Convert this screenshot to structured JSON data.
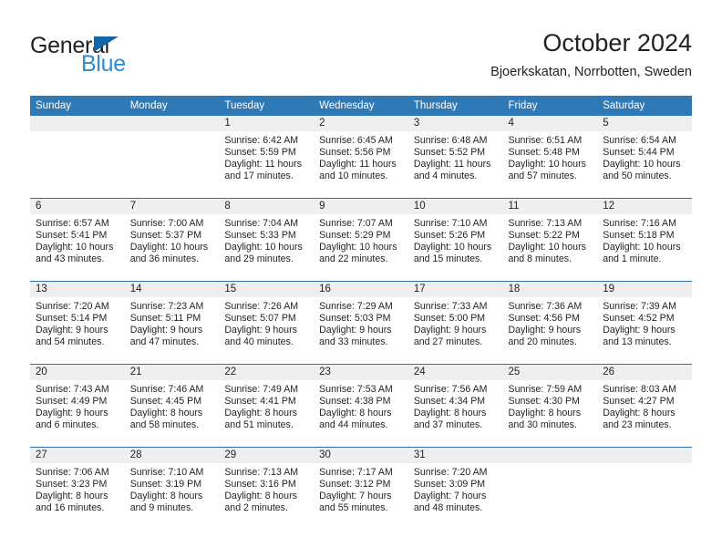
{
  "brand": {
    "name_part1": "General",
    "name_part2": "Blue",
    "triangle_color": "#1464aa",
    "blue_color": "#2e8bd0"
  },
  "header": {
    "title": "October 2024",
    "subtitle": "Bjoerkskatan, Norrbotten, Sweden"
  },
  "theme": {
    "header_row_bg": "#3079b7",
    "header_row_text": "#ffffff",
    "row_divider": "#2f73ad",
    "daynum_band_bg": "#efeff0",
    "text": "#231f20"
  },
  "weekdays": [
    "Sunday",
    "Monday",
    "Tuesday",
    "Wednesday",
    "Thursday",
    "Friday",
    "Saturday"
  ],
  "labels": {
    "sunrise_prefix": "Sunrise:",
    "sunset_prefix": "Sunset:",
    "daylight_prefix": "Daylight:"
  },
  "weeks": [
    [
      {
        "day": "",
        "empty": true,
        "l1": "",
        "l2": "",
        "l3": "",
        "l4": ""
      },
      {
        "day": "",
        "empty": true,
        "l1": "",
        "l2": "",
        "l3": "",
        "l4": ""
      },
      {
        "day": "1",
        "empty": false,
        "l1": "Sunrise: 6:42 AM",
        "l2": "Sunset: 5:59 PM",
        "l3": "Daylight: 11 hours",
        "l4": "and 17 minutes."
      },
      {
        "day": "2",
        "empty": false,
        "l1": "Sunrise: 6:45 AM",
        "l2": "Sunset: 5:56 PM",
        "l3": "Daylight: 11 hours",
        "l4": "and 10 minutes."
      },
      {
        "day": "3",
        "empty": false,
        "l1": "Sunrise: 6:48 AM",
        "l2": "Sunset: 5:52 PM",
        "l3": "Daylight: 11 hours",
        "l4": "and 4 minutes."
      },
      {
        "day": "4",
        "empty": false,
        "l1": "Sunrise: 6:51 AM",
        "l2": "Sunset: 5:48 PM",
        "l3": "Daylight: 10 hours",
        "l4": "and 57 minutes."
      },
      {
        "day": "5",
        "empty": false,
        "l1": "Sunrise: 6:54 AM",
        "l2": "Sunset: 5:44 PM",
        "l3": "Daylight: 10 hours",
        "l4": "and 50 minutes."
      }
    ],
    [
      {
        "day": "6",
        "empty": false,
        "l1": "Sunrise: 6:57 AM",
        "l2": "Sunset: 5:41 PM",
        "l3": "Daylight: 10 hours",
        "l4": "and 43 minutes."
      },
      {
        "day": "7",
        "empty": false,
        "l1": "Sunrise: 7:00 AM",
        "l2": "Sunset: 5:37 PM",
        "l3": "Daylight: 10 hours",
        "l4": "and 36 minutes."
      },
      {
        "day": "8",
        "empty": false,
        "l1": "Sunrise: 7:04 AM",
        "l2": "Sunset: 5:33 PM",
        "l3": "Daylight: 10 hours",
        "l4": "and 29 minutes."
      },
      {
        "day": "9",
        "empty": false,
        "l1": "Sunrise: 7:07 AM",
        "l2": "Sunset: 5:29 PM",
        "l3": "Daylight: 10 hours",
        "l4": "and 22 minutes."
      },
      {
        "day": "10",
        "empty": false,
        "l1": "Sunrise: 7:10 AM",
        "l2": "Sunset: 5:26 PM",
        "l3": "Daylight: 10 hours",
        "l4": "and 15 minutes."
      },
      {
        "day": "11",
        "empty": false,
        "l1": "Sunrise: 7:13 AM",
        "l2": "Sunset: 5:22 PM",
        "l3": "Daylight: 10 hours",
        "l4": "and 8 minutes."
      },
      {
        "day": "12",
        "empty": false,
        "l1": "Sunrise: 7:16 AM",
        "l2": "Sunset: 5:18 PM",
        "l3": "Daylight: 10 hours",
        "l4": "and 1 minute."
      }
    ],
    [
      {
        "day": "13",
        "empty": false,
        "l1": "Sunrise: 7:20 AM",
        "l2": "Sunset: 5:14 PM",
        "l3": "Daylight: 9 hours",
        "l4": "and 54 minutes."
      },
      {
        "day": "14",
        "empty": false,
        "l1": "Sunrise: 7:23 AM",
        "l2": "Sunset: 5:11 PM",
        "l3": "Daylight: 9 hours",
        "l4": "and 47 minutes."
      },
      {
        "day": "15",
        "empty": false,
        "l1": "Sunrise: 7:26 AM",
        "l2": "Sunset: 5:07 PM",
        "l3": "Daylight: 9 hours",
        "l4": "and 40 minutes."
      },
      {
        "day": "16",
        "empty": false,
        "l1": "Sunrise: 7:29 AM",
        "l2": "Sunset: 5:03 PM",
        "l3": "Daylight: 9 hours",
        "l4": "and 33 minutes."
      },
      {
        "day": "17",
        "empty": false,
        "l1": "Sunrise: 7:33 AM",
        "l2": "Sunset: 5:00 PM",
        "l3": "Daylight: 9 hours",
        "l4": "and 27 minutes."
      },
      {
        "day": "18",
        "empty": false,
        "l1": "Sunrise: 7:36 AM",
        "l2": "Sunset: 4:56 PM",
        "l3": "Daylight: 9 hours",
        "l4": "and 20 minutes."
      },
      {
        "day": "19",
        "empty": false,
        "l1": "Sunrise: 7:39 AM",
        "l2": "Sunset: 4:52 PM",
        "l3": "Daylight: 9 hours",
        "l4": "and 13 minutes."
      }
    ],
    [
      {
        "day": "20",
        "empty": false,
        "l1": "Sunrise: 7:43 AM",
        "l2": "Sunset: 4:49 PM",
        "l3": "Daylight: 9 hours",
        "l4": "and 6 minutes."
      },
      {
        "day": "21",
        "empty": false,
        "l1": "Sunrise: 7:46 AM",
        "l2": "Sunset: 4:45 PM",
        "l3": "Daylight: 8 hours",
        "l4": "and 58 minutes."
      },
      {
        "day": "22",
        "empty": false,
        "l1": "Sunrise: 7:49 AM",
        "l2": "Sunset: 4:41 PM",
        "l3": "Daylight: 8 hours",
        "l4": "and 51 minutes."
      },
      {
        "day": "23",
        "empty": false,
        "l1": "Sunrise: 7:53 AM",
        "l2": "Sunset: 4:38 PM",
        "l3": "Daylight: 8 hours",
        "l4": "and 44 minutes."
      },
      {
        "day": "24",
        "empty": false,
        "l1": "Sunrise: 7:56 AM",
        "l2": "Sunset: 4:34 PM",
        "l3": "Daylight: 8 hours",
        "l4": "and 37 minutes."
      },
      {
        "day": "25",
        "empty": false,
        "l1": "Sunrise: 7:59 AM",
        "l2": "Sunset: 4:30 PM",
        "l3": "Daylight: 8 hours",
        "l4": "and 30 minutes."
      },
      {
        "day": "26",
        "empty": false,
        "l1": "Sunrise: 8:03 AM",
        "l2": "Sunset: 4:27 PM",
        "l3": "Daylight: 8 hours",
        "l4": "and 23 minutes."
      }
    ],
    [
      {
        "day": "27",
        "empty": false,
        "l1": "Sunrise: 7:06 AM",
        "l2": "Sunset: 3:23 PM",
        "l3": "Daylight: 8 hours",
        "l4": "and 16 minutes."
      },
      {
        "day": "28",
        "empty": false,
        "l1": "Sunrise: 7:10 AM",
        "l2": "Sunset: 3:19 PM",
        "l3": "Daylight: 8 hours",
        "l4": "and 9 minutes."
      },
      {
        "day": "29",
        "empty": false,
        "l1": "Sunrise: 7:13 AM",
        "l2": "Sunset: 3:16 PM",
        "l3": "Daylight: 8 hours",
        "l4": "and 2 minutes."
      },
      {
        "day": "30",
        "empty": false,
        "l1": "Sunrise: 7:17 AM",
        "l2": "Sunset: 3:12 PM",
        "l3": "Daylight: 7 hours",
        "l4": "and 55 minutes."
      },
      {
        "day": "31",
        "empty": false,
        "l1": "Sunrise: 7:20 AM",
        "l2": "Sunset: 3:09 PM",
        "l3": "Daylight: 7 hours",
        "l4": "and 48 minutes."
      },
      {
        "day": "",
        "empty": true,
        "l1": "",
        "l2": "",
        "l3": "",
        "l4": ""
      },
      {
        "day": "",
        "empty": true,
        "l1": "",
        "l2": "",
        "l3": "",
        "l4": ""
      }
    ]
  ]
}
